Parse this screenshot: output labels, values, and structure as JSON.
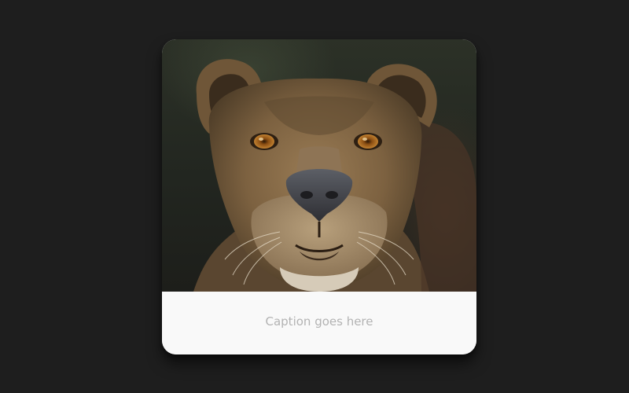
{
  "card": {
    "caption": "Caption goes here",
    "image_subject": "lioness-portrait"
  },
  "colors": {
    "page_background": "#1e1e1e",
    "card_background": "#f9f9f9",
    "caption_text": "#b3b3b3"
  }
}
